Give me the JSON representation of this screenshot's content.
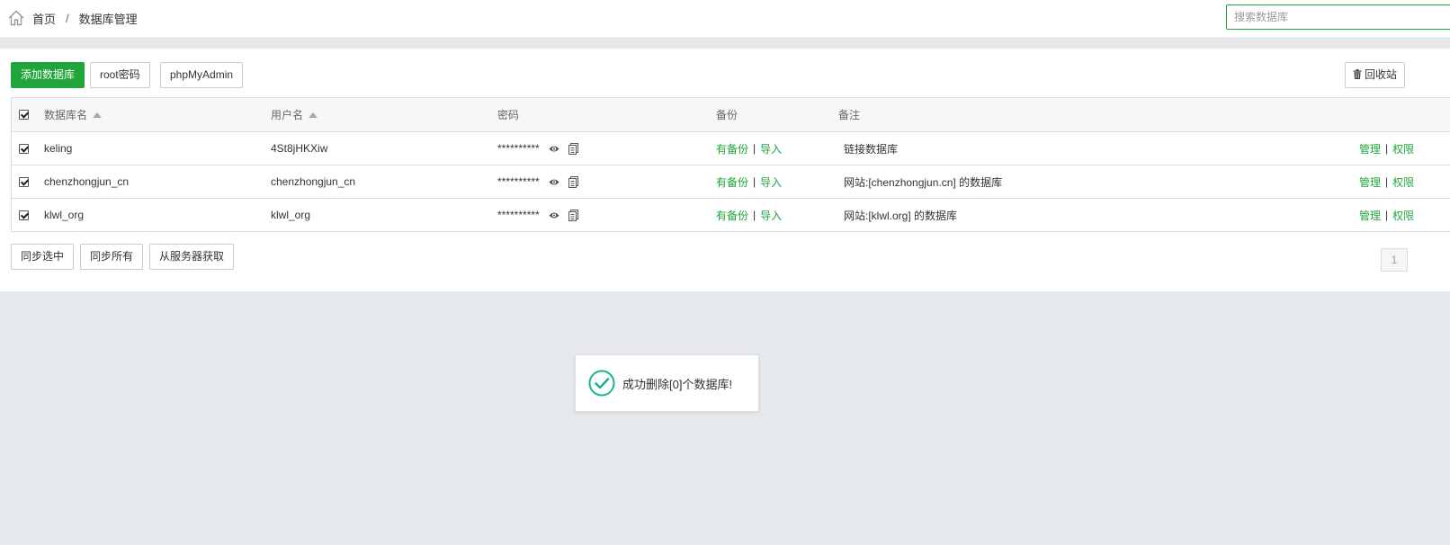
{
  "breadcrumb": {
    "home": "首页",
    "separator": "/",
    "current": "数据库管理"
  },
  "search": {
    "placeholder": "搜索数据库",
    "value": ""
  },
  "toolbar": {
    "add_db": "添加数据库",
    "root_pwd": "root密码",
    "phpmyadmin": "phpMyAdmin",
    "recycle_bin": "回收站"
  },
  "table": {
    "headers": {
      "name": "数据库名",
      "user": "用户名",
      "password": "密码",
      "backup": "备份",
      "note": "备注"
    },
    "rows": [
      {
        "name": "keling",
        "user": "4St8jHKXiw",
        "password": "**********",
        "backup": "有备份",
        "import": "导入",
        "note": "链接数据库",
        "manage": "管理",
        "perm": "权限"
      },
      {
        "name": "chenzhongjun_cn",
        "user": "chenzhongjun_cn",
        "password": "**********",
        "backup": "有备份",
        "import": "导入",
        "note": "网站:[chenzhongjun.cn] 的数据库",
        "manage": "管理",
        "perm": "权限"
      },
      {
        "name": "klwl_org",
        "user": "klwl_org",
        "password": "**********",
        "backup": "有备份",
        "import": "导入",
        "note": "网站:[klwl.org] 的数据库",
        "manage": "管理",
        "perm": "权限"
      }
    ]
  },
  "actions": {
    "sync_selected": "同步选中",
    "sync_all": "同步所有",
    "fetch_server": "从服务器获取"
  },
  "pagination": {
    "current": "1"
  },
  "toast": {
    "message": "成功删除[0]个数据库!"
  },
  "colors": {
    "accent": "#20a53a",
    "toast_check": "#1ab394"
  }
}
